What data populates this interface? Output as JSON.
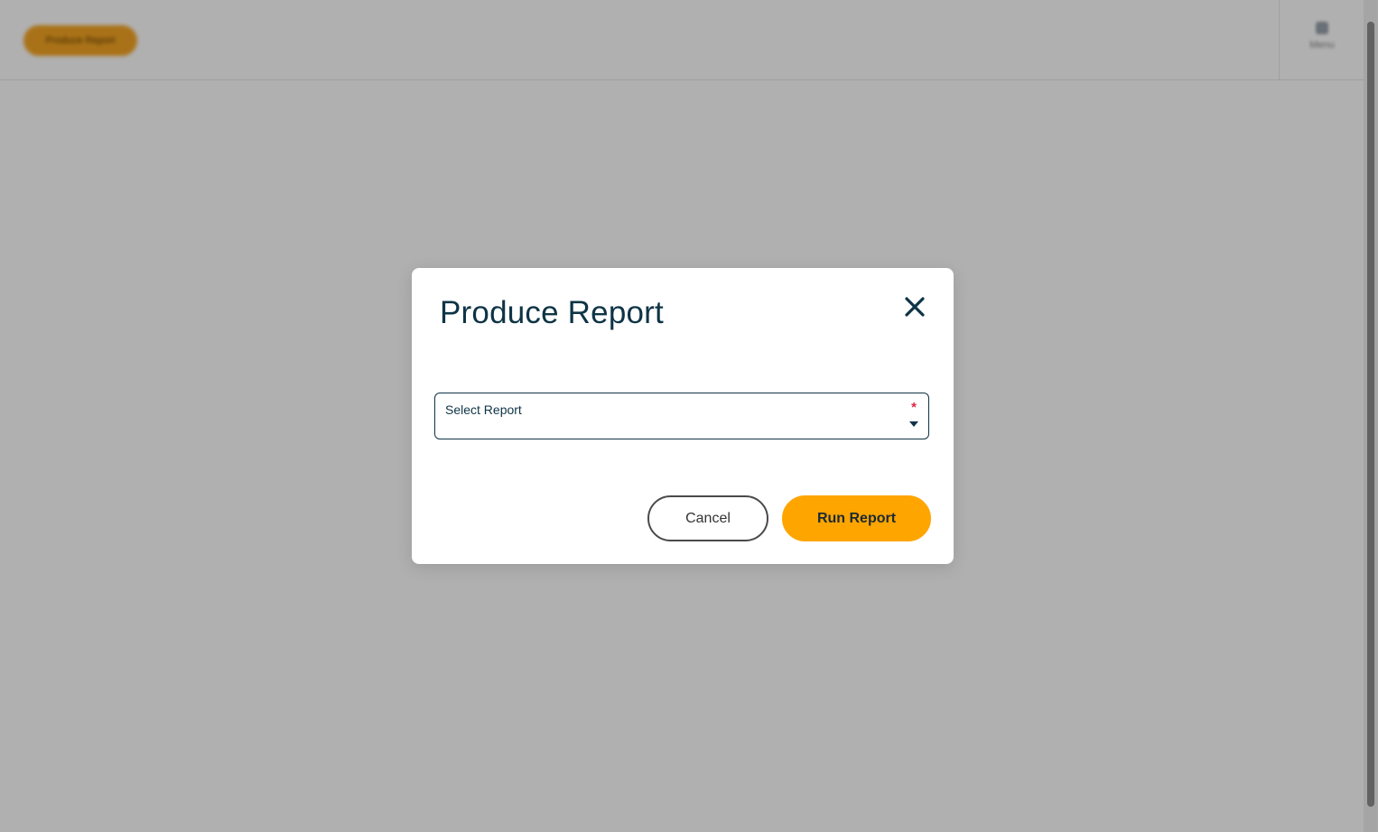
{
  "background": {
    "header_button_label": "Produce Report",
    "menu_label": "Menu"
  },
  "dialog": {
    "title": "Produce Report",
    "select": {
      "label": "Select Report",
      "required_marker": "*",
      "value": ""
    },
    "buttons": {
      "cancel": "Cancel",
      "run": "Run Report"
    }
  },
  "colors": {
    "primary_text": "#0e3446",
    "accent": "#ffa500",
    "required": "#e0283e",
    "overlay": "rgba(0,0,0,0.31)"
  },
  "icons": {
    "close": "close-icon",
    "dropdown": "chevron-down-icon"
  }
}
